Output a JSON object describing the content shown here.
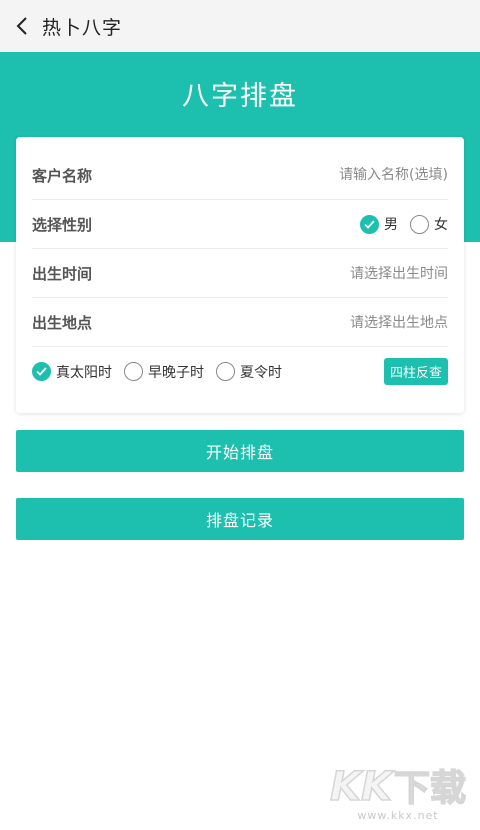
{
  "header": {
    "title": "热卜八字"
  },
  "hero": {
    "title": "八字排盘"
  },
  "form": {
    "name": {
      "label": "客户名称",
      "placeholder": "请输入名称(选填)"
    },
    "gender": {
      "label": "选择性别",
      "options": [
        "男",
        "女"
      ],
      "selected": "男"
    },
    "birth_time": {
      "label": "出生时间",
      "placeholder": "请选择出生时间"
    },
    "birth_place": {
      "label": "出生地点",
      "placeholder": "请选择出生地点"
    },
    "time_options": [
      {
        "label": "真太阳时",
        "checked": true
      },
      {
        "label": "早晚子时",
        "checked": false
      },
      {
        "label": "夏令时",
        "checked": false
      }
    ],
    "reverse_lookup_label": "四柱反查"
  },
  "actions": {
    "start_label": "开始排盘",
    "records_label": "排盘记录"
  },
  "watermark": {
    "logo_k1": "K",
    "logo_k2": "K",
    "logo_zh": "下载",
    "url": "www.kkx.net"
  },
  "colors": {
    "accent": "#1dbfae",
    "topbar": "#f4f4f4"
  }
}
